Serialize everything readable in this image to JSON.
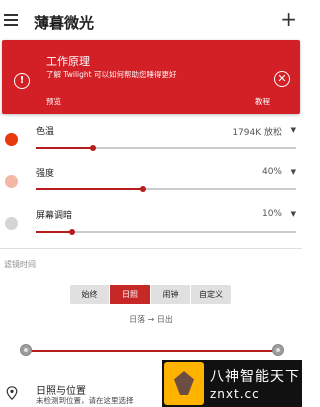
{
  "header": {
    "title": "薄暮微光",
    "menu_icon": "hamburger-menu-icon",
    "add_icon": "plus-icon"
  },
  "info_card": {
    "title": "工作原理",
    "description": "了解 Twilight 可以如何帮助您睡得更好",
    "action_left": "预览",
    "action_right": "教程",
    "color": "#d32026"
  },
  "settings": [
    {
      "label": "色温",
      "value": "1794K 放松",
      "has_caret": true,
      "dot_color": "#e8380d",
      "level": 0.22
    },
    {
      "label": "强度",
      "value": "40%",
      "has_caret": true,
      "dot_color": "#f4b7a6",
      "level": 0.41
    },
    {
      "label": "屏幕调暗",
      "value": "10%",
      "has_caret": true,
      "dot_color": "#d5d5d5",
      "level": 0.14
    }
  ],
  "filter_section": {
    "label": "滤镜时间",
    "modes": [
      "始终",
      "日照",
      "闹钟",
      "自定义"
    ],
    "active_mode": "日照",
    "schedule_text": "日落 → 日出"
  },
  "location": {
    "title": "日照与位置",
    "subtitle": "未检测到位置，请在这里选择"
  },
  "watermark": {
    "line1": "八神智能天下",
    "line2": "znxt.cc"
  }
}
